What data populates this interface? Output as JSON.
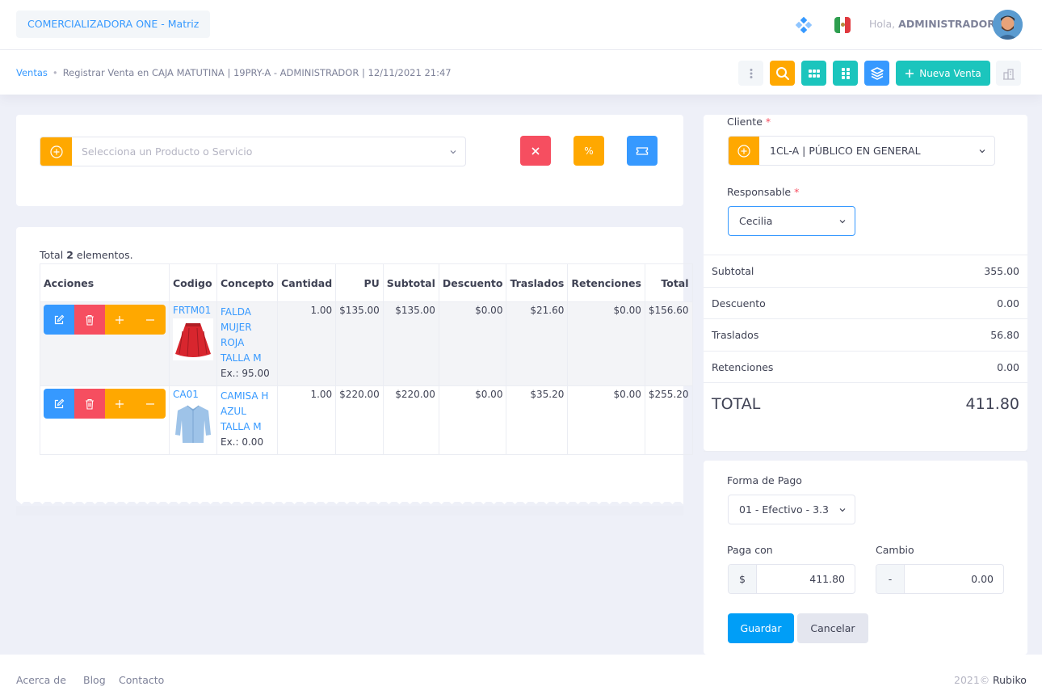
{
  "topbar": {
    "company": "COMERCIALIZADORA ONE - Matriz",
    "greeting": "Hola,",
    "user": "ADMINISTRADOR"
  },
  "subheader": {
    "breadcrumb_link": "Ventas",
    "breadcrumb_text": "Registrar Venta en CAJA MATUTINA | 19PRY-A - ADMINISTRADOR | 12/11/2021 21:47",
    "new_sale_label": "Nueva Venta"
  },
  "product_search": {
    "placeholder": "Selecciona un Producto o Servicio",
    "percent_label": "%"
  },
  "items": {
    "total_prefix": "Total",
    "total_count": "2",
    "total_suffix": "elementos.",
    "headers": [
      "Acciones",
      "Codigo",
      "Concepto",
      "Cantidad",
      "PU",
      "Subtotal",
      "Descuento",
      "Traslados",
      "Retenciones",
      "Total"
    ],
    "rows": [
      {
        "code": "FRTM01",
        "concept": [
          "FALDA",
          "MUJER",
          "ROJA",
          "TALLA M"
        ],
        "stock": "Ex.: 95.00",
        "qty": "1.00",
        "pu": "$135.00",
        "subtotal": "$135.00",
        "discount": "$0.00",
        "transfers": "$21.60",
        "withholdings": "$0.00",
        "total": "$156.60"
      },
      {
        "code": "CA01",
        "concept": [
          "CAMISA H",
          "AZUL",
          "TALLA M"
        ],
        "stock": "Ex.: 0.00",
        "qty": "1.00",
        "pu": "$220.00",
        "subtotal": "$220.00",
        "discount": "$0.00",
        "transfers": "$35.20",
        "withholdings": "$0.00",
        "total": "$255.20"
      }
    ]
  },
  "sidebar": {
    "client_label": "Cliente",
    "client_value": "1CL-A | PÚBLICO EN GENERAL",
    "responsible_label": "Responsable",
    "responsible_value": "Cecilia",
    "summary": [
      {
        "label": "Subtotal",
        "value": "355.00"
      },
      {
        "label": "Descuento",
        "value": "0.00"
      },
      {
        "label": "Traslados",
        "value": "56.80"
      },
      {
        "label": "Retenciones",
        "value": "0.00"
      }
    ],
    "total_label": "TOTAL",
    "total_value": "411.80",
    "payment_label": "Forma de Pago",
    "payment_value": "01 - Efectivo - 3.3",
    "pays_with_label": "Paga con",
    "pays_with_prefix": "$",
    "pays_with_value": "411.80",
    "change_label": "Cambio",
    "change_prefix": "-",
    "change_value": "0.00",
    "save_label": "Guardar",
    "cancel_label": "Cancelar"
  },
  "footer": {
    "links": [
      "Acerca de",
      "Blog",
      "Contacto"
    ],
    "year": "2021©",
    "brand": "Rubiko"
  },
  "colors": {
    "primary": "#3699ff",
    "success": "#1bc5bd",
    "warning": "#ffa800",
    "danger": "#f64e60",
    "info": "#0bb7af"
  }
}
